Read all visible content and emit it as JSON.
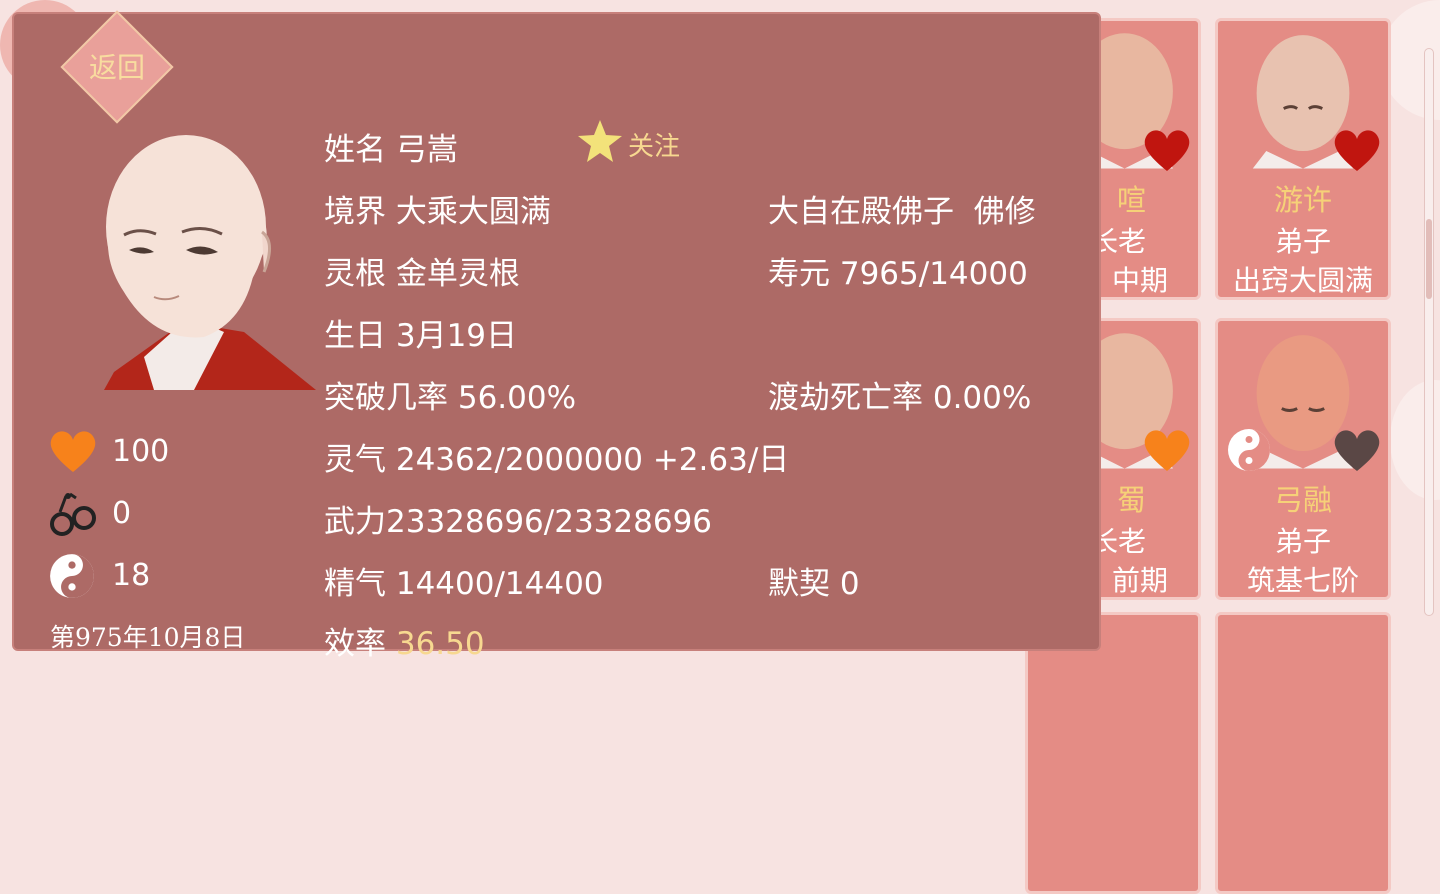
{
  "back_label": "返回",
  "profile": {
    "name_label": "姓名",
    "name": "弓嵩",
    "follow_label": "关注",
    "realm_label": "境界",
    "realm": "大乘大圆满",
    "title": "大自在殿佛子",
    "sect_type": "佛修",
    "root_label": "灵根",
    "root": "金单灵根",
    "lifespan_label": "寿元",
    "lifespan": "7965/14000",
    "birthday_label": "生日",
    "birthday": "3月19日",
    "breakthrough_label": "突破几率",
    "breakthrough": "56.00%",
    "tribulation_label": "渡劫死亡率",
    "tribulation": "0.00%",
    "qi_label": "灵气",
    "qi": "24362/2000000 +2.63/日",
    "force_label": "武力",
    "force": "23328696/23328696",
    "essence_label": "精气",
    "essence": "14400/14400",
    "bond_label": "默契",
    "bond": "0",
    "efficiency_label": "效率",
    "efficiency": "36.50"
  },
  "stats": {
    "affection": "100",
    "shackles": "0",
    "yinyang": "18"
  },
  "date": "第975年10月8日",
  "cards": [
    {
      "name": "喧",
      "role": "长老",
      "realm": "中期",
      "heart_color": "#c0150f"
    },
    {
      "name": "游许",
      "role": "弟子",
      "realm": "出窍大圆满",
      "heart_color": "#c0150f"
    },
    {
      "name": "蜀",
      "role": "长老",
      "realm": "前期",
      "heart_color": "#f7821b"
    },
    {
      "name": "弓融",
      "role": "弟子",
      "realm": "筑基七阶",
      "heart_color": "#5a4745"
    }
  ],
  "colors": {
    "dialog": "#ad6a66",
    "card": "#e48c85",
    "gold": "#f7d890"
  }
}
